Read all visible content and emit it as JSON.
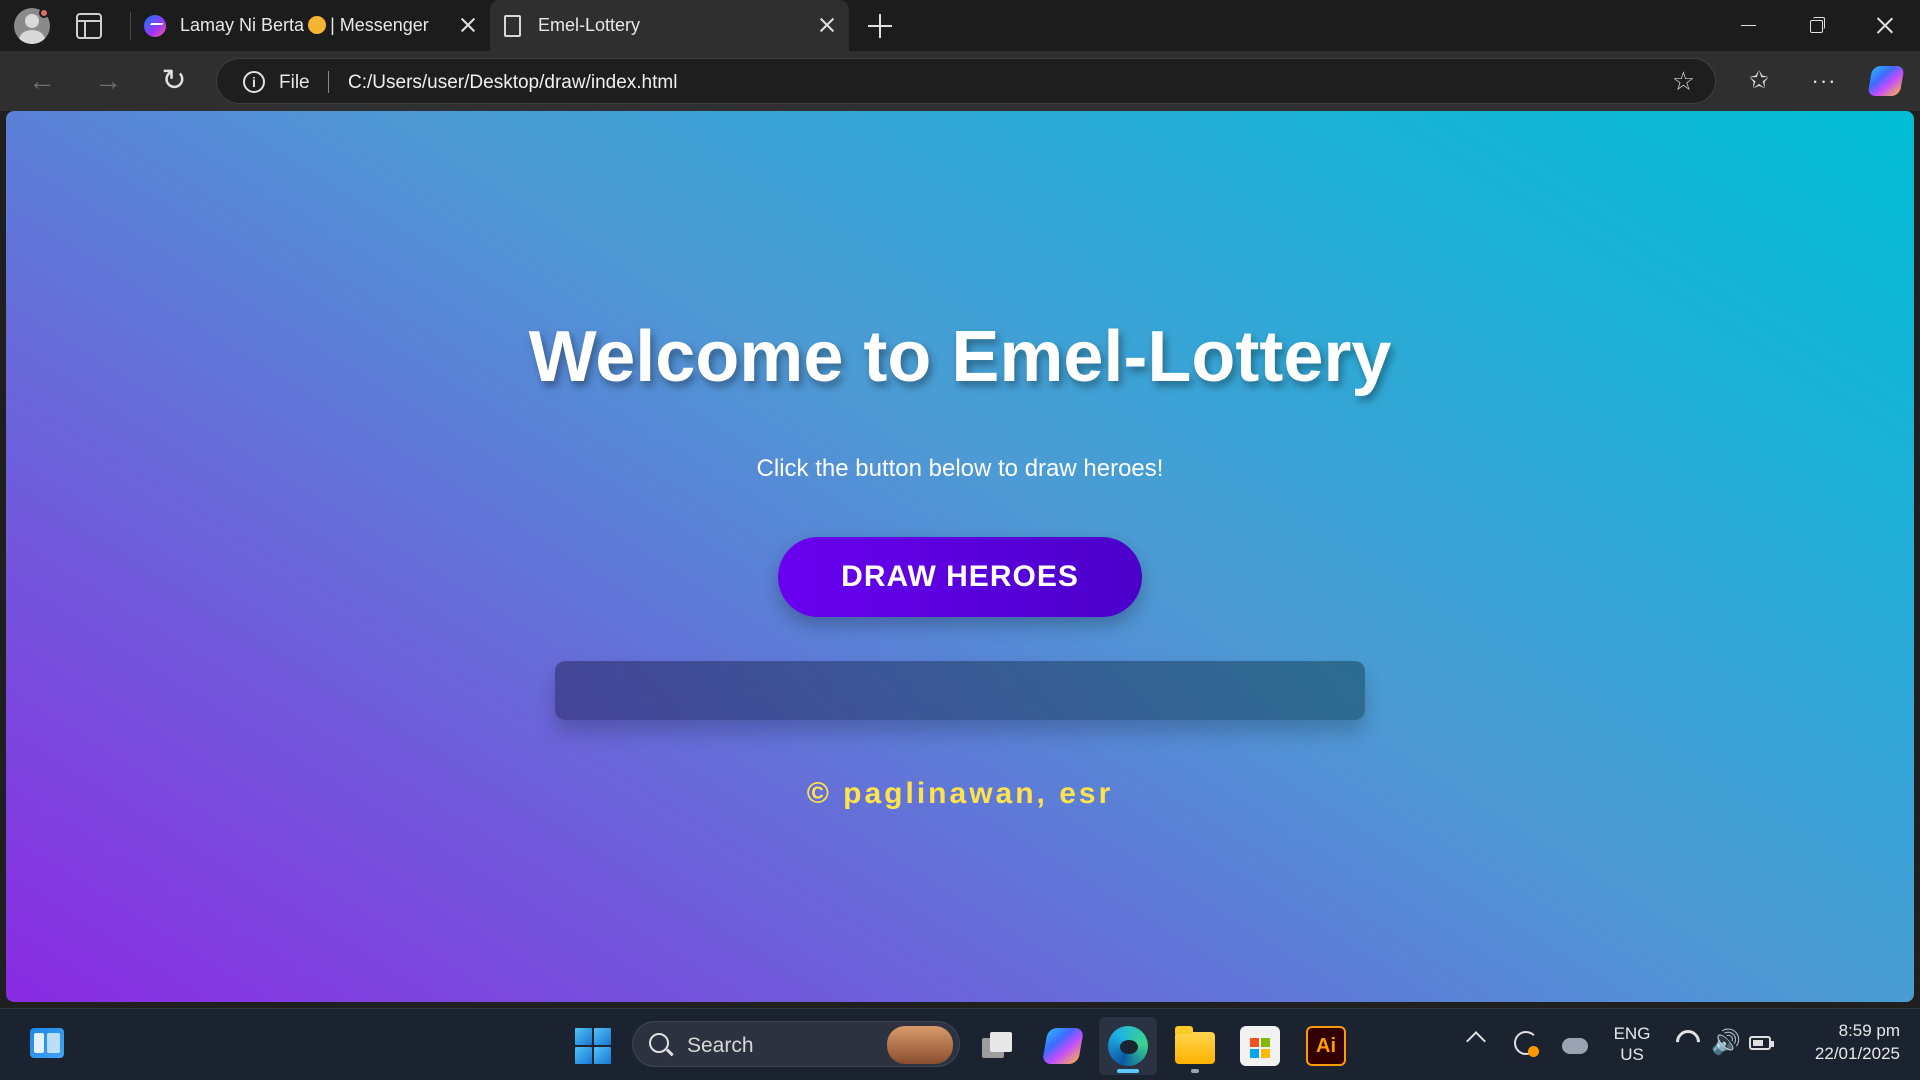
{
  "browser": {
    "tabs": [
      {
        "title_prefix": "Lamay Ni Berta",
        "title_suffix": "| Messenger",
        "icon": "messenger-icon"
      },
      {
        "title": "Emel-Lottery",
        "icon": "page-icon",
        "active": true
      }
    ],
    "address": {
      "scheme_label": "File",
      "url": "C:/Users/user/Desktop/draw/index.html"
    },
    "icons": [
      "profile-avatar",
      "tab-actions-icon",
      "back-icon",
      "forward-icon",
      "reload-icon",
      "info-icon",
      "favorite-star-icon",
      "favorites-icon",
      "more-icon",
      "copilot-icon",
      "minimize-icon",
      "restore-icon",
      "close-icon"
    ]
  },
  "page": {
    "heading": "Welcome to Emel-Lottery",
    "subtitle": "Click the button below to draw heroes!",
    "draw_button_label": "DRAW HEROES",
    "result": "",
    "credit": "© paglinawan, esr",
    "colors": {
      "gradient_start": "#8a2be2",
      "gradient_end": "#00bcd4",
      "button": "#5a00e0",
      "credit_text": "#ffe34d"
    }
  },
  "taskbar": {
    "search_label": "Search",
    "language": {
      "line1": "ENG",
      "line2": "US"
    },
    "time": "8:59 pm",
    "date": "22/01/2025",
    "apps": [
      "widgets-icon",
      "start-icon",
      "task-view-icon",
      "copilot-icon",
      "edge-icon",
      "file-explorer-icon",
      "store-icon",
      "illustrator-icon"
    ],
    "illustrator_label": "Ai"
  }
}
